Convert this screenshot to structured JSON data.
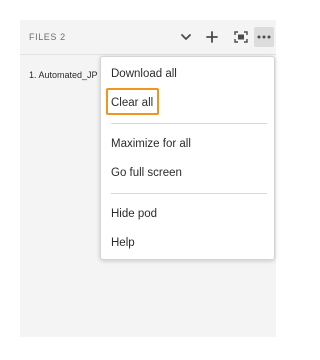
{
  "pod": {
    "title": "FILES 2",
    "files": [
      {
        "name": "1. Automated_JP"
      }
    ]
  },
  "header_icons": {
    "collapse": "chevron-down-icon",
    "add": "plus-icon",
    "fit": "fit-to-screen-icon",
    "more": "more-options-icon"
  },
  "menu": {
    "download_all": "Download all",
    "clear_all": "Clear all",
    "maximize_for_all": "Maximize for all",
    "go_full_screen": "Go full screen",
    "hide_pod": "Hide pod",
    "help": "Help"
  },
  "colors": {
    "highlight": "#f0961e",
    "pod_background": "#f4f4f4",
    "text": "#2c2c2c"
  }
}
